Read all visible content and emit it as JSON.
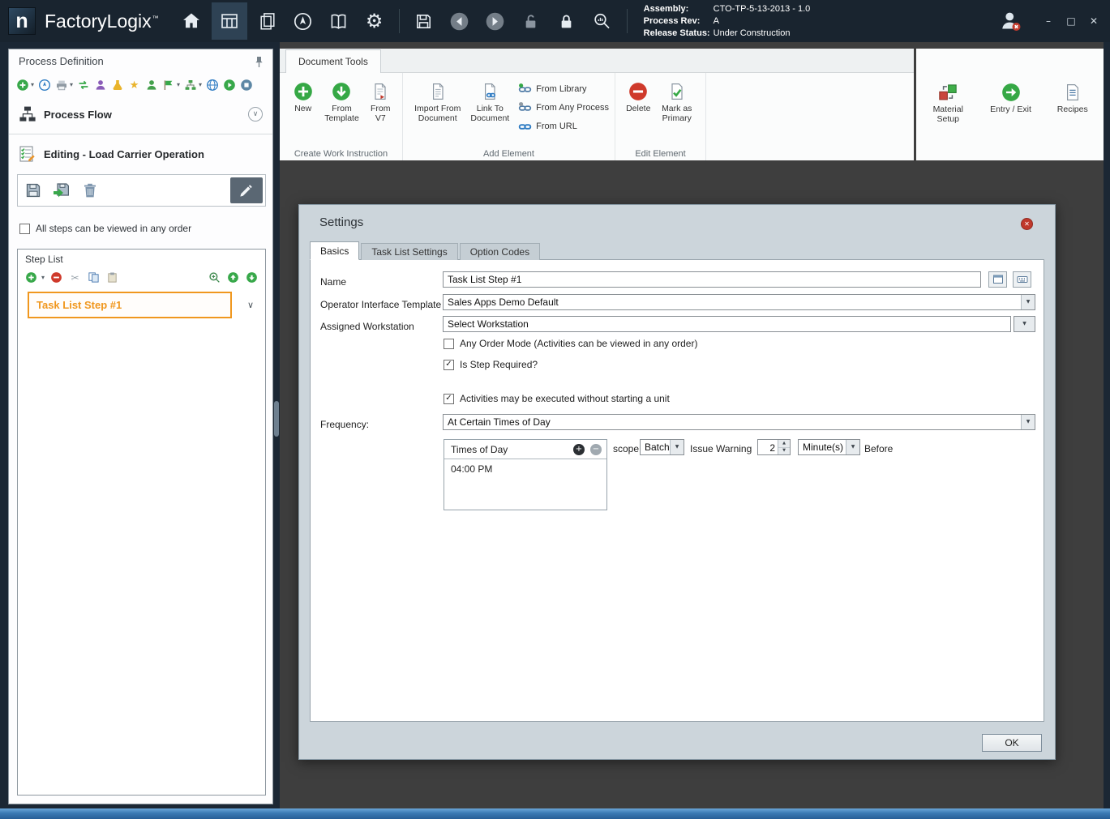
{
  "colors": {
    "titlebar_bg": "#19242F",
    "canvas_bg": "#3E3E3E",
    "dialog_bg": "#CCD5DB",
    "accent_orange": "#F0971E",
    "accent_green": "#35A845",
    "accent_red": "#CF3A2B"
  },
  "icons": {
    "gear": "⚙",
    "scissors": "✂",
    "star": "★",
    "caret_down": "▾",
    "dropdown_arrow": "▼",
    "spinner_up": "▲",
    "spinner_down": "▼",
    "check": "✓",
    "chevron_down": "∨",
    "plus": "+",
    "minus": "−",
    "close": "✕",
    "minimize": "–",
    "maximize": "□"
  },
  "titlebar": {
    "logo_letter": "n",
    "app_name": "FactoryLogix",
    "trademark": "™",
    "assembly_label": "Assembly:",
    "assembly_value": "CTO-TP-5-13-2013 - 1.0",
    "process_rev_label": "Process Rev:",
    "process_rev_value": "A",
    "release_status_label": "Release Status:",
    "release_status_value": "Under Construction"
  },
  "left_panel": {
    "title": "Process Definition",
    "process_flow_label": "Process Flow",
    "editing_label": "Editing - Load Carrier Operation",
    "order_checkbox_label": "All steps can be viewed in any order",
    "step_list_title": "Step List",
    "steps": [
      {
        "label": "Task List Step #1"
      }
    ]
  },
  "ribbon": {
    "tab_label": "Document Tools",
    "create_group_label": "Create Work Instruction",
    "new_label": "New",
    "from_template_label": "From Template",
    "from_v7_label": "From V7",
    "add_group_label": "Add Element",
    "import_from_document_label": "Import From Document",
    "link_to_document_label": "Link To Document",
    "from_library_label": "From Library",
    "from_any_process_label": "From Any Process",
    "from_url_label": "From URL",
    "edit_group_label": "Edit Element",
    "delete_label": "Delete",
    "mark_as_primary_label": "Mark as Primary",
    "material_setup_label": "Material Setup",
    "entry_exit_label": "Entry / Exit",
    "recipes_label": "Recipes"
  },
  "dialog": {
    "title": "Settings",
    "tabs": [
      {
        "label": "Basics"
      },
      {
        "label": "Task List Settings"
      },
      {
        "label": "Option Codes"
      }
    ],
    "name_label": "Name",
    "name_value": "Task List Step #1",
    "template_label": "Operator Interface Template",
    "template_value": "Sales Apps Demo Default",
    "workstation_label": "Assigned Workstation",
    "workstation_value": "Select Workstation",
    "any_order_label": "Any Order Mode (Activities can be viewed in any order)",
    "step_required_label": "Is Step Required?",
    "activities_label": "Activities may be executed without starting a unit",
    "frequency_label": "Frequency:",
    "frequency_value": "At Certain Times of Day",
    "times_title": "Times of Day",
    "times": [
      {
        "value": "04:00 PM"
      }
    ],
    "scope_label": "scope",
    "scope_value": "Batch",
    "issue_warning_label": "Issue Warning",
    "warning_value": "2",
    "warning_unit": "Minute(s)",
    "before_label": "Before",
    "ok_label": "OK"
  }
}
